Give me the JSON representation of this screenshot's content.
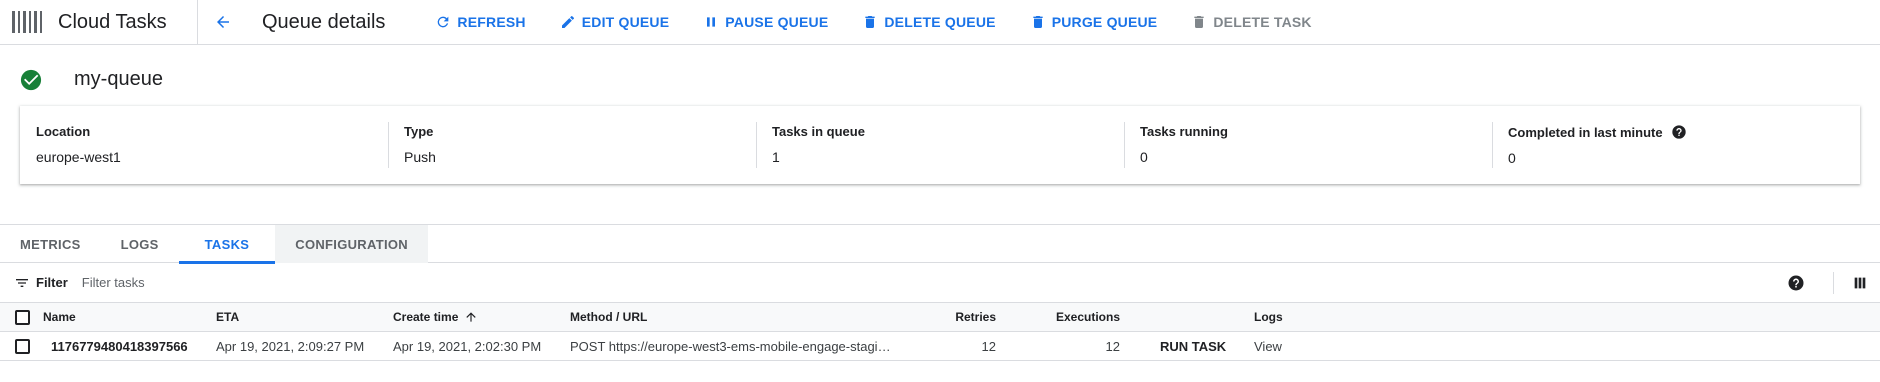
{
  "header": {
    "product_name": "Cloud Tasks",
    "page_title": "Queue details",
    "actions": [
      {
        "label": "REFRESH",
        "icon": "refresh-icon",
        "enabled": true
      },
      {
        "label": "EDIT QUEUE",
        "icon": "pencil-icon",
        "enabled": true
      },
      {
        "label": "PAUSE QUEUE",
        "icon": "pause-icon",
        "enabled": true
      },
      {
        "label": "DELETE QUEUE",
        "icon": "trash-icon",
        "enabled": true
      },
      {
        "label": "PURGE QUEUE",
        "icon": "trash-icon",
        "enabled": true
      },
      {
        "label": "DELETE TASK",
        "icon": "trash-icon",
        "enabled": false
      }
    ]
  },
  "queue": {
    "name": "my-queue",
    "status_icon": "check-circle-icon",
    "status_color": "#188038"
  },
  "details": [
    {
      "label": "Location",
      "value": "europe-west1"
    },
    {
      "label": "Type",
      "value": "Push"
    },
    {
      "label": "Tasks in queue",
      "value": "1"
    },
    {
      "label": "Tasks running",
      "value": "0"
    },
    {
      "label": "Completed in last minute",
      "value": "0",
      "help_icon": "help-circle-icon"
    }
  ],
  "tabs": [
    {
      "label": "METRICS",
      "active": false
    },
    {
      "label": "LOGS",
      "active": false
    },
    {
      "label": "TASKS",
      "active": true
    },
    {
      "label": "CONFIGURATION",
      "active": false
    }
  ],
  "filter": {
    "label": "Filter",
    "placeholder": "Filter tasks"
  },
  "table": {
    "columns": [
      "Name",
      "ETA",
      "Create time",
      "Method / URL",
      "Retries",
      "Executions",
      "",
      "Logs"
    ],
    "sorted_column": "Create time",
    "sort_direction": "ascending",
    "rows": [
      {
        "name": "1176779480418397566",
        "eta": "Apr 19, 2021, 2:09:27 PM",
        "create_time": "Apr 19, 2021, 2:02:30 PM",
        "method_url": "POST https://europe-west3-ems-mobile-engage-stagi…",
        "retries": "12",
        "executions": "12",
        "run_label": "RUN TASK",
        "logs_label": "View"
      }
    ]
  },
  "colors": {
    "accent": "#1a73e8",
    "disabled": "#80868b",
    "success": "#188038"
  }
}
